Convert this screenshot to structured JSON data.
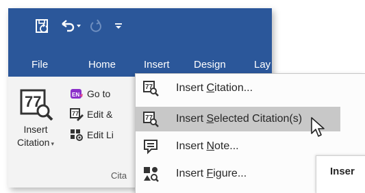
{
  "quick_access": {
    "save_icon": "save-icon",
    "undo_icon": "undo-icon",
    "redo_icon": "redo-icon",
    "customize_glyph": "₹"
  },
  "tabs": {
    "file": "File",
    "home": "Home",
    "insert": "Insert",
    "design": "Design",
    "layout": "Lay"
  },
  "ribbon": {
    "insert_citation_line1": "Insert",
    "insert_citation_line2": "Citation",
    "caret": "▾",
    "goto_label": "Go to",
    "edit_label": "Edit &",
    "edit_library_label": "Edit Li",
    "group_label": "Cita"
  },
  "menu": {
    "items": [
      {
        "pre": "Insert ",
        "key": "C",
        "post": "itation...",
        "icon": "insert-citation-icon"
      },
      {
        "pre": "Insert ",
        "key": "S",
        "post": "elected Citation(s)",
        "icon": "insert-selected-citations-icon"
      },
      {
        "pre": "Insert ",
        "key": "N",
        "post": "ote...",
        "icon": "insert-note-icon"
      },
      {
        "pre": "Insert ",
        "key": "F",
        "post": "igure...",
        "icon": "insert-figure-icon"
      }
    ],
    "highlighted_index": 1
  },
  "tooltip": {
    "title": "Inser"
  },
  "colors": {
    "ribbon_blue": "#2b579a",
    "ribbon_body": "#f3f3f3",
    "menu_highlight": "#c8c8c8",
    "text": "#262626"
  }
}
